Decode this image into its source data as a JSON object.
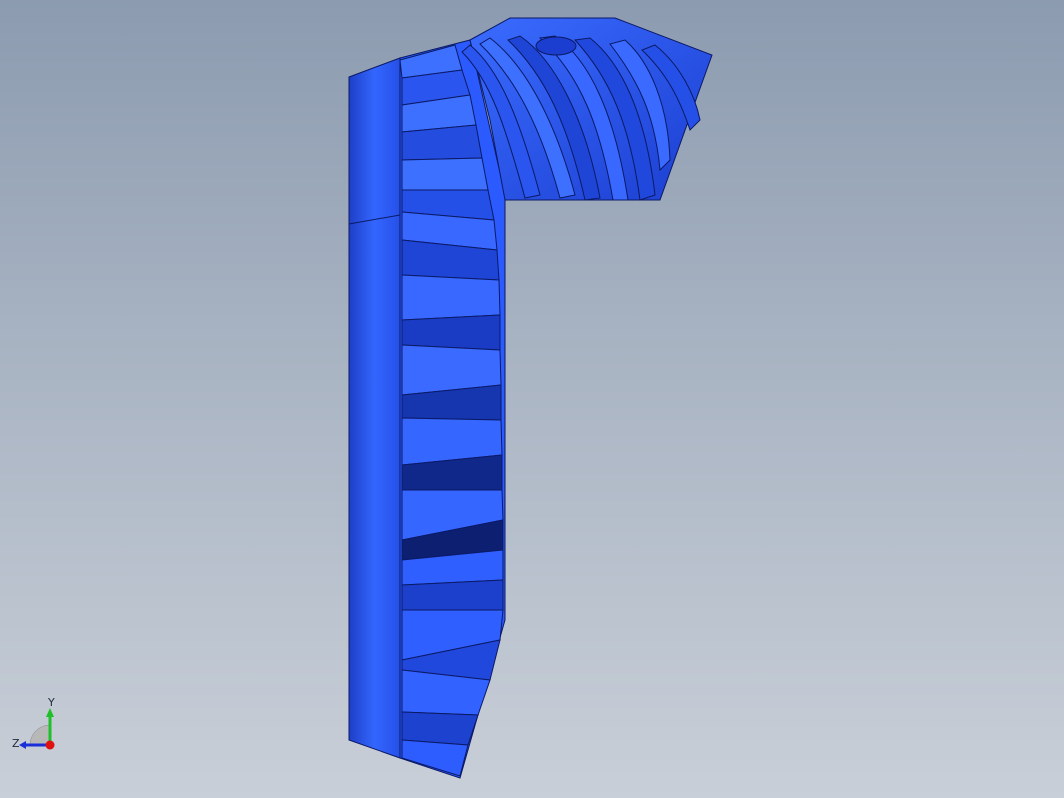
{
  "viewport": {
    "background_top": "#8c9bb0",
    "background_bottom": "#c9cfd8"
  },
  "model": {
    "name": "bevel-gear",
    "color": "#2a5cff"
  },
  "triad": {
    "y_label": "Y",
    "z_label": "Z",
    "y_axis_color": "#1fbf2a",
    "z_axis_color": "#1b2fd8",
    "x_axis_color": "#e01010"
  }
}
